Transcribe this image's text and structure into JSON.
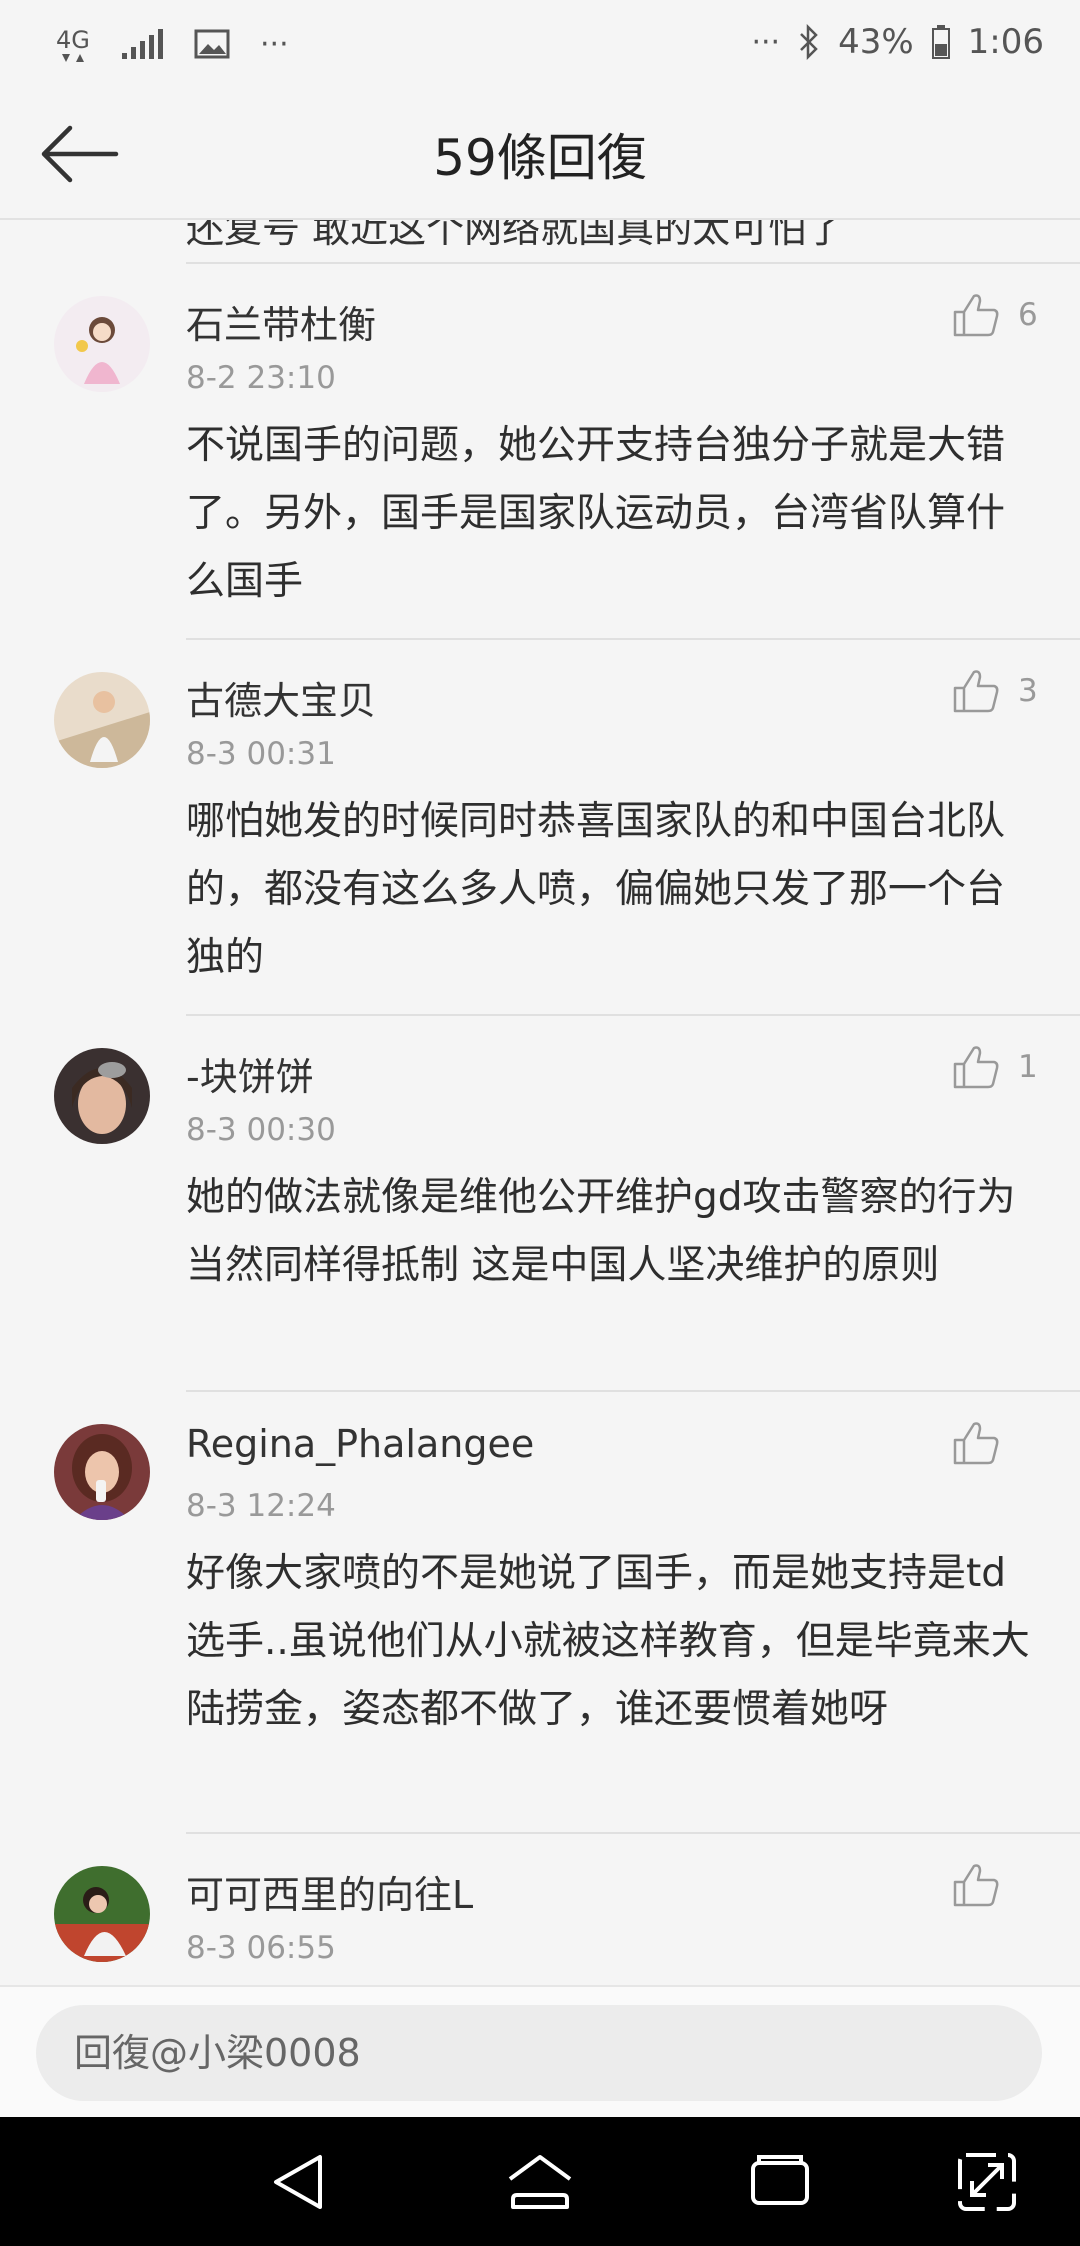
{
  "status_bar": {
    "network": "4G",
    "battery": "43%",
    "time": "1:06",
    "more": "···"
  },
  "header": {
    "title": "59條回復"
  },
  "partial_comment": "还复号 敢近这个网络就国真的太可怕了",
  "comments": [
    {
      "user": "石兰带杜衡",
      "time": "8-2 23:10",
      "likes": "6",
      "text": "不说国手的问题，她公开支持台独分子就是大错了。另外，国手是国家队运动员，台湾省队算什么国手"
    },
    {
      "user": "古德大宝贝",
      "time": "8-3 00:31",
      "likes": "3",
      "text": "哪怕她发的时候同时恭喜国家队的和中国台北队的，都没有这么多人喷，偏偏她只发了那一个台独的"
    },
    {
      "user": "-块饼饼",
      "time": "8-3 00:30",
      "likes": "1",
      "text": "她的做法就像是维他公开维护gd攻击警察的行为 当然同样得抵制 这是中国人坚决维护的原则"
    },
    {
      "user": "Regina_Phalangee",
      "time": "8-3 12:24",
      "likes": "",
      "text": "好像大家喷的不是她说了国手，而是她支持是td选手..虽说他们从小就被这样教育，但是毕竟来大陆捞金，姿态都不做了，谁还要惯着她呀"
    },
    {
      "user": "可可西里的向往L",
      "time": "8-3 06:55",
      "likes": "",
      "text": ""
    }
  ],
  "reply_input": {
    "placeholder": "回復@小梁0008"
  },
  "colors": {
    "background": "#f5f5f5",
    "meta_text": "#999999",
    "navbar": "#000000"
  }
}
